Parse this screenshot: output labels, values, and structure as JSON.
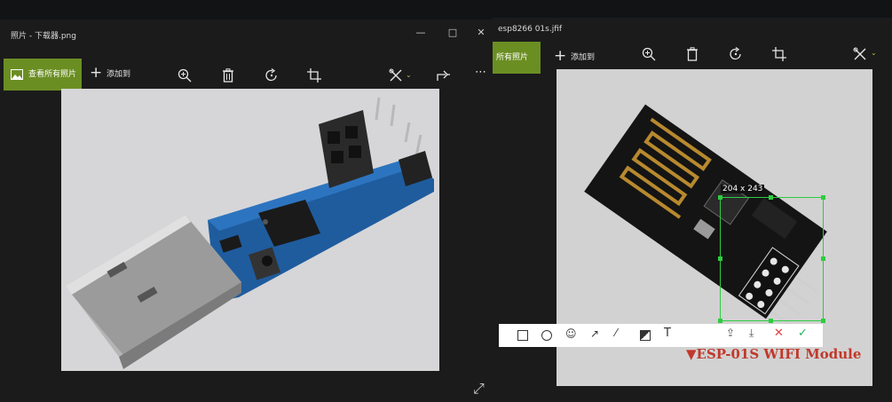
{
  "left_window": {
    "title": "照片 - 下载器.png",
    "see_all": "查看所有照片",
    "add_to": "添加到",
    "minimize": "—",
    "maximize": "□",
    "close": "✕"
  },
  "right_window": {
    "title": "esp8266 01s.jfif",
    "see_all": "所有照片",
    "add_to": "添加到",
    "selection_size": "204 x 243",
    "caption": "▼ESP-01S WIFI Module"
  },
  "icons": {
    "zoom": "zoom-in-icon",
    "delete": "trash-icon",
    "rotate": "rotate-icon",
    "crop": "crop-icon",
    "edit": "edit-create-icon",
    "share": "share-icon",
    "more": "more-icon",
    "expand": "expand-icon"
  },
  "markup_tools": [
    "rectangle",
    "ellipse",
    "emoji",
    "arrow",
    "pen",
    "mosaic",
    "text",
    "share",
    "save",
    "cancel",
    "confirm"
  ],
  "colors": {
    "accent_green": "#6b8e23",
    "selection_green": "#2ecc40",
    "caption_red": "#c0392b"
  }
}
